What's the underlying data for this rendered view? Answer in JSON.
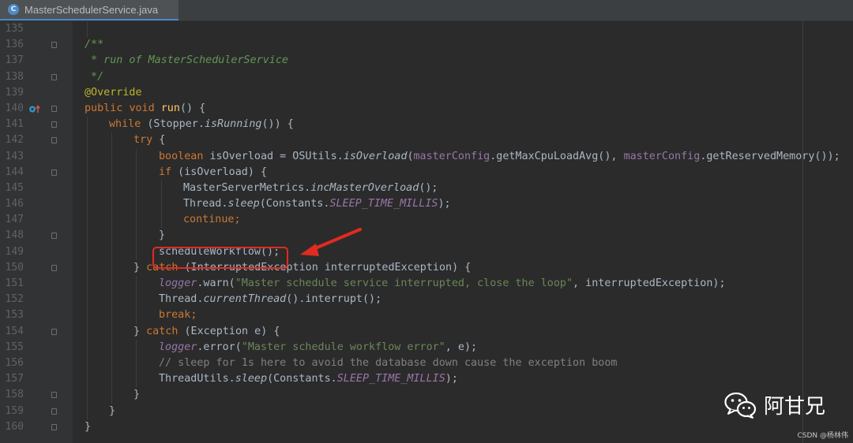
{
  "tab": {
    "icon_letter": "C",
    "title": "MasterSchedulerService.java"
  },
  "lines": [
    {
      "n": "135"
    },
    {
      "n": "136",
      "t": "/**"
    },
    {
      "n": "137",
      "t": " * run of MasterSchedulerService"
    },
    {
      "n": "138",
      "t": " */"
    },
    {
      "n": "139",
      "t": "@Override"
    },
    {
      "n": "140",
      "a": "public",
      "b": "void",
      "c": "run",
      "d": "() {"
    },
    {
      "n": "141",
      "a": "while",
      "b": " (Stopper.",
      "c": "isRunning",
      "d": "()) {"
    },
    {
      "n": "142",
      "a": "try",
      "b": " {"
    },
    {
      "n": "143",
      "a": "boolean",
      "b": " isOverload = OSUtils.",
      "c": "isOverload",
      "d": "(",
      "e": "masterConfig",
      "f": ".getMaxCpuLoadAvg(), ",
      "g": "masterConfig",
      "h": ".getReservedMemory());"
    },
    {
      "n": "144",
      "a": "if",
      "b": " (isOverload) {"
    },
    {
      "n": "145",
      "a": "MasterServerMetrics.",
      "b": "incMasterOverload",
      "c": "();"
    },
    {
      "n": "146",
      "a": "Thread.",
      "b": "sleep",
      "c": "(Constants.",
      "d": "SLEEP_TIME_MILLIS",
      "e": ");"
    },
    {
      "n": "147",
      "a": "continue",
      "b": ";"
    },
    {
      "n": "148",
      "t": "}"
    },
    {
      "n": "149",
      "t": "scheduleWorkflow();"
    },
    {
      "n": "150",
      "a": "} ",
      "b": "catch",
      "c": " (InterruptedException interruptedException) {"
    },
    {
      "n": "151",
      "a": "logger",
      "b": ".warn(",
      "c": "\"Master schedule service interrupted, close the loop\"",
      "d": ", interruptedException);"
    },
    {
      "n": "152",
      "a": "Thread.",
      "b": "currentThread",
      "c": "().interrupt();"
    },
    {
      "n": "153",
      "a": "break",
      "b": ";"
    },
    {
      "n": "154",
      "a": "} ",
      "b": "catch",
      "c": " (Exception e) {"
    },
    {
      "n": "155",
      "a": "logger",
      "b": ".error(",
      "c": "\"Master schedule workflow error\"",
      "d": ", e);"
    },
    {
      "n": "156",
      "t": "// sleep for 1s here to avoid the database down cause the exception boom"
    },
    {
      "n": "157",
      "a": "ThreadUtils.",
      "b": "sleep",
      "c": "(Constants.",
      "d": "SLEEP_TIME_MILLIS",
      "e": ");"
    },
    {
      "n": "158",
      "t": "}"
    },
    {
      "n": "159",
      "t": "}"
    },
    {
      "n": "160",
      "t": "}"
    }
  ],
  "watermark": {
    "text": "阿甘兄"
  },
  "csdn": {
    "text": "CSDN @杨林伟"
  },
  "colors": {
    "highlight": "#e02b20",
    "arrow": "#e02b20"
  }
}
